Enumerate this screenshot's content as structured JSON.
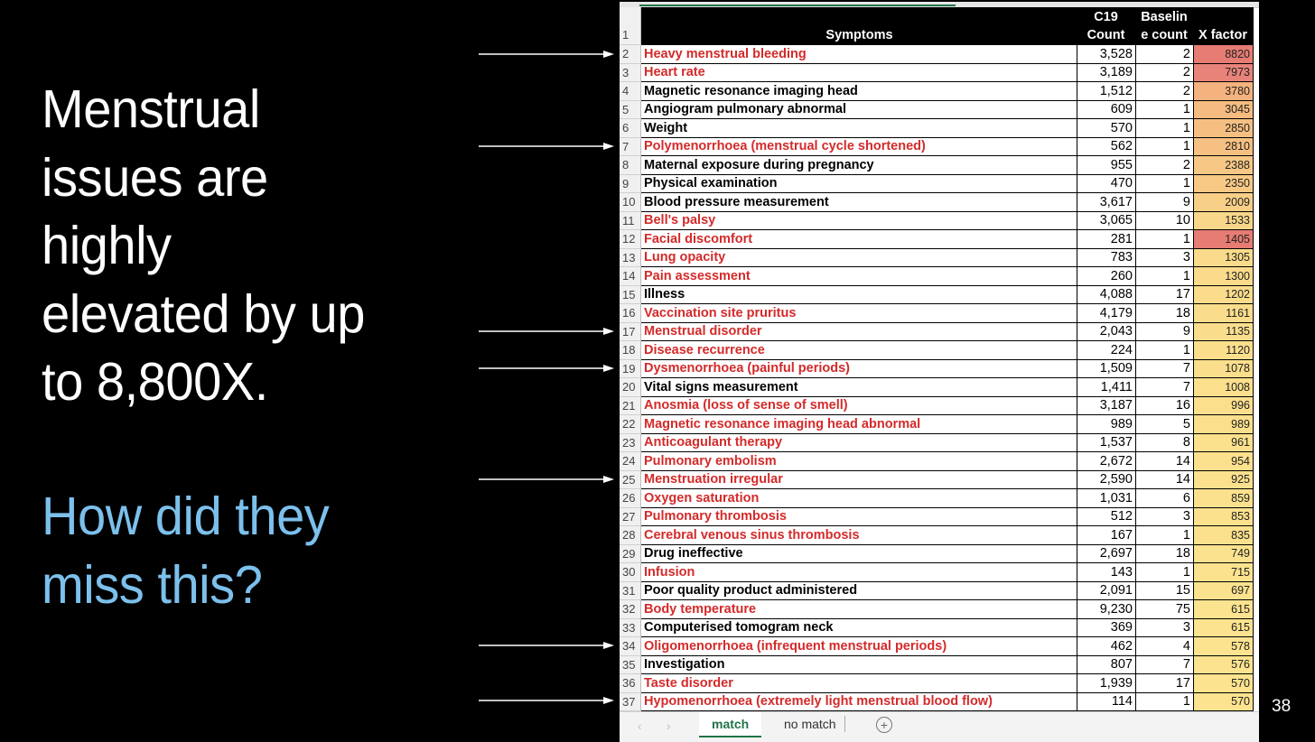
{
  "slide": {
    "headline_lines": [
      "Menstrual",
      "issues are",
      "highly",
      "elevated by up",
      "to 8,800X."
    ],
    "question_lines": [
      "How did they",
      "miss this?"
    ],
    "slide_number": "38",
    "colors": {
      "background": "#000000",
      "headline": "#ffffff",
      "question": "#7cc0ec",
      "highlight_text": "#d42a2a"
    },
    "arrows": [
      {
        "points_to_row": 2,
        "icon": "right-arrow-icon"
      },
      {
        "points_to_row": 7,
        "icon": "right-arrow-icon"
      },
      {
        "points_to_row": 17,
        "icon": "right-arrow-icon"
      },
      {
        "points_to_row": 19,
        "icon": "right-arrow-icon"
      },
      {
        "points_to_row": 25,
        "icon": "right-arrow-icon"
      },
      {
        "points_to_row": 34,
        "icon": "right-arrow-icon"
      },
      {
        "points_to_row": 37,
        "icon": "right-arrow-icon"
      }
    ]
  },
  "spreadsheet": {
    "header": {
      "row_number": "1",
      "symptoms": "Symptoms",
      "c19_line1": "C19",
      "c19_line2": "Count",
      "baseline_line1": "Baselin",
      "baseline_line2": "e count",
      "xfactor": "X factor"
    },
    "rows": [
      {
        "n": "2",
        "symptom": "Heavy menstrual bleeding",
        "c19": "3,528",
        "baseline": "2",
        "xfactor": "8820",
        "highlight": true,
        "fill": "#e67c73"
      },
      {
        "n": "3",
        "symptom": "Heart rate",
        "c19": "3,189",
        "baseline": "2",
        "xfactor": "7973",
        "highlight": true,
        "fill": "#e8837a"
      },
      {
        "n": "4",
        "symptom": "Magnetic resonance imaging head",
        "c19": "1,512",
        "baseline": "2",
        "xfactor": "3780",
        "highlight": false,
        "fill": "#f4b27e"
      },
      {
        "n": "5",
        "symptom": "Angiogram pulmonary abnormal",
        "c19": "609",
        "baseline": "1",
        "xfactor": "3045",
        "highlight": false,
        "fill": "#f5bb80"
      },
      {
        "n": "6",
        "symptom": "Weight",
        "c19": "570",
        "baseline": "1",
        "xfactor": "2850",
        "highlight": false,
        "fill": "#f6bf82"
      },
      {
        "n": "7",
        "symptom": "Polymenorrhoea (menstrual cycle shortened)",
        "c19": "562",
        "baseline": "1",
        "xfactor": "2810",
        "highlight": true,
        "fill": "#f6c082"
      },
      {
        "n": "8",
        "symptom": "Maternal exposure during pregnancy",
        "c19": "955",
        "baseline": "2",
        "xfactor": "2388",
        "highlight": false,
        "fill": "#f7c885"
      },
      {
        "n": "9",
        "symptom": "Physical examination",
        "c19": "470",
        "baseline": "1",
        "xfactor": "2350",
        "highlight": false,
        "fill": "#f7c985"
      },
      {
        "n": "10",
        "symptom": "Blood pressure measurement",
        "c19": "3,617",
        "baseline": "9",
        "xfactor": "2009",
        "highlight": false,
        "fill": "#f8cf87"
      },
      {
        "n": "11",
        "symptom": "Bell's palsy",
        "c19": "3,065",
        "baseline": "10",
        "xfactor": "1533",
        "highlight": true,
        "fill": "#f9d78a"
      },
      {
        "n": "12",
        "symptom": "Facial discomfort",
        "c19": "281",
        "baseline": "1",
        "xfactor": "1405",
        "highlight": true,
        "fill": "#e67c73"
      },
      {
        "n": "13",
        "symptom": "Lung opacity",
        "c19": "783",
        "baseline": "3",
        "xfactor": "1305",
        "highlight": true,
        "fill": "#fadb8b"
      },
      {
        "n": "14",
        "symptom": "Pain assessment",
        "c19": "260",
        "baseline": "1",
        "xfactor": "1300",
        "highlight": true,
        "fill": "#fadb8b"
      },
      {
        "n": "15",
        "symptom": "Illness",
        "c19": "4,088",
        "baseline": "17",
        "xfactor": "1202",
        "highlight": false,
        "fill": "#fadc8c"
      },
      {
        "n": "16",
        "symptom": "Vaccination site pruritus",
        "c19": "4,179",
        "baseline": "18",
        "xfactor": "1161",
        "highlight": true,
        "fill": "#fadd8c"
      },
      {
        "n": "17",
        "symptom": "Menstrual disorder",
        "c19": "2,043",
        "baseline": "9",
        "xfactor": "1135",
        "highlight": true,
        "fill": "#fadd8c"
      },
      {
        "n": "18",
        "symptom": "Disease recurrence",
        "c19": "224",
        "baseline": "1",
        "xfactor": "1120",
        "highlight": true,
        "fill": "#fade8c"
      },
      {
        "n": "19",
        "symptom": "Dysmenorrhoea (painful periods)",
        "c19": "1,509",
        "baseline": "7",
        "xfactor": "1078",
        "highlight": true,
        "fill": "#fade8c"
      },
      {
        "n": "20",
        "symptom": "Vital signs measurement",
        "c19": "1,411",
        "baseline": "7",
        "xfactor": "1008",
        "highlight": false,
        "fill": "#fbdf8d"
      },
      {
        "n": "21",
        "symptom": "Anosmia (loss of sense of smell)",
        "c19": "3,187",
        "baseline": "16",
        "xfactor": "996",
        "highlight": true,
        "fill": "#fbdf8d"
      },
      {
        "n": "22",
        "symptom": "Magnetic resonance imaging head abnormal",
        "c19": "989",
        "baseline": "5",
        "xfactor": "989",
        "highlight": true,
        "fill": "#fbdf8d"
      },
      {
        "n": "23",
        "symptom": "Anticoagulant therapy",
        "c19": "1,537",
        "baseline": "8",
        "xfactor": "961",
        "highlight": true,
        "fill": "#fbe08d"
      },
      {
        "n": "24",
        "symptom": "Pulmonary embolism",
        "c19": "2,672",
        "baseline": "14",
        "xfactor": "954",
        "highlight": true,
        "fill": "#fbe08d"
      },
      {
        "n": "25",
        "symptom": "Menstruation irregular",
        "c19": "2,590",
        "baseline": "14",
        "xfactor": "925",
        "highlight": true,
        "fill": "#fbe08d"
      },
      {
        "n": "26",
        "symptom": "Oxygen saturation",
        "c19": "1,031",
        "baseline": "6",
        "xfactor": "859",
        "highlight": true,
        "fill": "#fbe18e"
      },
      {
        "n": "27",
        "symptom": "Pulmonary thrombosis",
        "c19": "512",
        "baseline": "3",
        "xfactor": "853",
        "highlight": true,
        "fill": "#fbe18e"
      },
      {
        "n": "28",
        "symptom": "Cerebral venous sinus thrombosis",
        "c19": "167",
        "baseline": "1",
        "xfactor": "835",
        "highlight": true,
        "fill": "#fbe18e"
      },
      {
        "n": "29",
        "symptom": "Drug ineffective",
        "c19": "2,697",
        "baseline": "18",
        "xfactor": "749",
        "highlight": false,
        "fill": "#fbe28e"
      },
      {
        "n": "30",
        "symptom": "Infusion",
        "c19": "143",
        "baseline": "1",
        "xfactor": "715",
        "highlight": true,
        "fill": "#fbe28e"
      },
      {
        "n": "31",
        "symptom": "Poor quality product administered",
        "c19": "2,091",
        "baseline": "15",
        "xfactor": "697",
        "highlight": false,
        "fill": "#fbe28e"
      },
      {
        "n": "32",
        "symptom": "Body temperature",
        "c19": "9,230",
        "baseline": "75",
        "xfactor": "615",
        "highlight": true,
        "fill": "#fbe38f"
      },
      {
        "n": "33",
        "symptom": "Computerised tomogram neck",
        "c19": "369",
        "baseline": "3",
        "xfactor": "615",
        "highlight": false,
        "fill": "#fbe38f"
      },
      {
        "n": "34",
        "symptom": "Oligomenorrhoea (infrequent menstrual periods)",
        "c19": "462",
        "baseline": "4",
        "xfactor": "578",
        "highlight": true,
        "fill": "#fbe38f"
      },
      {
        "n": "35",
        "symptom": "Investigation",
        "c19": "807",
        "baseline": "7",
        "xfactor": "576",
        "highlight": false,
        "fill": "#fbe38f"
      },
      {
        "n": "36",
        "symptom": "Taste disorder",
        "c19": "1,939",
        "baseline": "17",
        "xfactor": "570",
        "highlight": true,
        "fill": "#fbe38f"
      },
      {
        "n": "37",
        "symptom": "Hypomenorrhoea (extremely light menstrual blood flow)",
        "c19": "114",
        "baseline": "1",
        "xfactor": "570",
        "highlight": true,
        "fill": "#fbe38f"
      }
    ],
    "tabs": [
      {
        "label": "match",
        "active": true
      },
      {
        "label": "no match",
        "active": false
      }
    ],
    "nav_prev_icon": "‹",
    "nav_next_icon": "›",
    "add_sheet_icon": "+",
    "accent_color": "#217346"
  }
}
